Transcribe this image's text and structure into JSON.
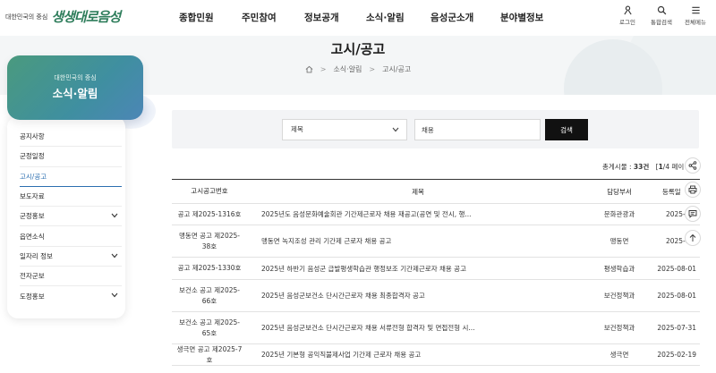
{
  "header": {
    "logo_tagline": "대한민국의 중심",
    "logo_name": "생생대로음성",
    "nav": [
      "종합민원",
      "주민참여",
      "정보공개",
      "소식·알림",
      "음성군소개",
      "분야별정보"
    ],
    "utils": [
      {
        "label": "로그인",
        "icon": "person-icon"
      },
      {
        "label": "통합검색",
        "icon": "search-icon"
      },
      {
        "label": "전체메뉴",
        "icon": "menu-icon"
      }
    ]
  },
  "page": {
    "title": "고시/공고",
    "breadcrumb": [
      "소식·알림",
      "고시/공고"
    ]
  },
  "sidebar": {
    "subtitle": "대한민국의 중심",
    "title": "소식·알림",
    "items": [
      {
        "label": "공지사항",
        "has_sub": false,
        "active": false
      },
      {
        "label": "군정일정",
        "has_sub": false,
        "active": false
      },
      {
        "label": "고시/공고",
        "has_sub": false,
        "active": true
      },
      {
        "label": "보도자료",
        "has_sub": false,
        "active": false
      },
      {
        "label": "군정홍보",
        "has_sub": true,
        "active": false
      },
      {
        "label": "읍면소식",
        "has_sub": false,
        "active": false
      },
      {
        "label": "일자리 정보",
        "has_sub": true,
        "active": false
      },
      {
        "label": "전자군보",
        "has_sub": false,
        "active": false
      },
      {
        "label": "도정홍보",
        "has_sub": true,
        "active": false
      }
    ]
  },
  "search": {
    "select_value": "제목",
    "input_value": "채용",
    "button_label": "검색"
  },
  "count": {
    "prefix": "총게시물 : ",
    "total": "33건",
    "page_open": "[",
    "page_current": "1",
    "page_rest": "/4 페이"
  },
  "table": {
    "headers": {
      "no": "고시공고번호",
      "title": "제목",
      "dept": "담당부서",
      "date": "등록일"
    },
    "rows": [
      {
        "no": "공고 제2025-1316호",
        "title": "2025년도 음성문화예술회관 기간제근로자 채용 재공고(공연 및 전시, 행...",
        "dept": "문화관광과",
        "date": "2025-08-"
      },
      {
        "no": "맹동면 공고 제2025-38호",
        "title": "맹동면 녹지조성 관리 기간제 근로자 채용 공고",
        "dept": "맹동면",
        "date": "2025-08-"
      },
      {
        "no": "공고 제2025-1330호",
        "title": "2025년 하반기 음성군 급발평생학습관 행정보조 기간제근로자 채용 공고",
        "dept": "평생학습과",
        "date": "2025-08-01"
      },
      {
        "no": "보건소 공고 제2025-66호",
        "title": "2025년 음성군보건소 단시간근로자 채용 최종합격자 공고",
        "dept": "보건정책과",
        "date": "2025-08-01"
      },
      {
        "no": "보건소 공고 제2025-65호",
        "title": "2025년 음성군보건소 단시간근로자 채용 서류전형 합격자 및 면접전형 시...",
        "dept": "보건정책과",
        "date": "2025-07-31"
      },
      {
        "no": "생극면 공고 제2025-7호",
        "title": "2025년 기본형 공익직불제사업 기간제 근로자 채용 공고",
        "dept": "생극면",
        "date": "2025-02-19"
      }
    ]
  },
  "floating_tools": [
    "share-icon",
    "print-icon",
    "comment-icon",
    "top-icon"
  ],
  "colors": {
    "brand_green": "#2e7d5b",
    "active_blue": "#2c6fb0",
    "search_button": "#111111"
  }
}
